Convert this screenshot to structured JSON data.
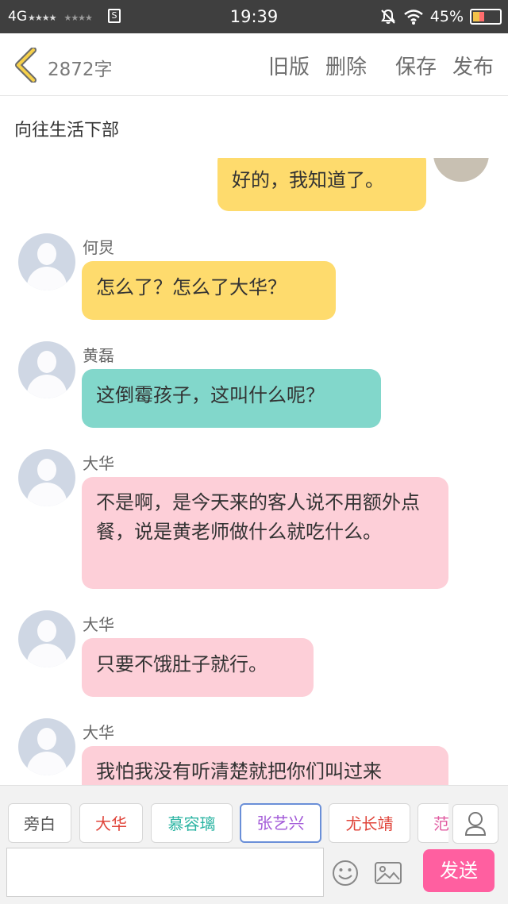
{
  "status_bar": {
    "network": "4G",
    "signal1": "★★★★",
    "signal2": "★★★★",
    "sim_icon": "S",
    "time": "19:39",
    "battery_percent": "45%",
    "battery_level": 0.45
  },
  "toolbar": {
    "word_count": "2872字",
    "old_version": "旧版",
    "delete": "删除",
    "save": "保存",
    "publish": "发布"
  },
  "story_title": "向往生活下部",
  "messages": [
    {
      "speaker": "",
      "text": "好的，我知道了。",
      "color": "#fedb6d",
      "self": true
    },
    {
      "speaker": "何炅",
      "text": "怎么了？怎么了大华？",
      "color": "#fedb6d"
    },
    {
      "speaker": "黄磊",
      "text": "这倒霉孩子，这叫什么呢？",
      "color": "#82d7cb"
    },
    {
      "speaker": "大华",
      "text": "不是啊，是今天来的客人说不用额外点餐，说是黄老师做什么就吃什么。",
      "color": "#fdcfd8"
    },
    {
      "speaker": "大华",
      "text": "只要不饿肚子就行。",
      "color": "#fdcfd8"
    },
    {
      "speaker": "大华",
      "text": "我怕我没有听清楚就把你们叫过来",
      "color": "#fdcfd8"
    }
  ],
  "characters": [
    {
      "label": "旁白",
      "color": "#555555"
    },
    {
      "label": "大华",
      "color": "#e0443a"
    },
    {
      "label": "慕容璃",
      "color": "#2db5a3"
    },
    {
      "label": "张艺兴",
      "color": "#a35bd8",
      "selected": true
    },
    {
      "label": "尤长靖",
      "color": "#e0443a"
    },
    {
      "label": "范",
      "color": "#e05aa0"
    }
  ],
  "input": {
    "value": "",
    "placeholder": ""
  },
  "send_label": "发送",
  "icons": {
    "back": "chevron-left-icon",
    "user": "user-icon",
    "emoji": "smiley-icon",
    "image": "image-icon",
    "mute": "bell-off-icon",
    "wifi": "wifi-icon"
  }
}
